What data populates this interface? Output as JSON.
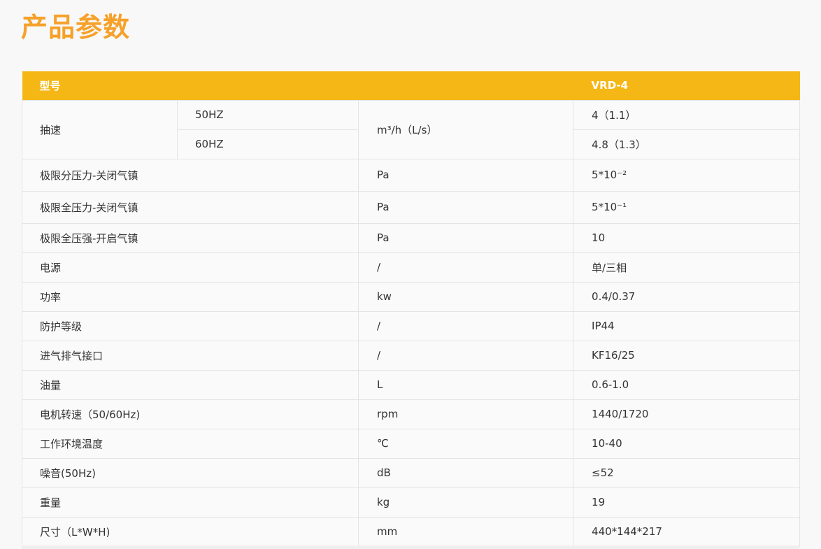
{
  "page_title": "产品参数",
  "header": {
    "model_label": "型号",
    "model_value": "VRD-4"
  },
  "speed": {
    "label": "抽速",
    "freq_50": "50HZ",
    "freq_60": "60HZ",
    "unit": "m³/h（L/s）",
    "value_50": "4（1.1）",
    "value_60": "4.8（1.3）"
  },
  "rows": [
    {
      "name": "极限分压力-关闭气镇",
      "unit": "Pa",
      "value": "5*10⁻²"
    },
    {
      "name": "极限全压力-关闭气镇",
      "unit": "Pa",
      "value": "5*10⁻¹"
    },
    {
      "name": "极限全压强-开启气镇",
      "unit": "Pa",
      "value": "10"
    },
    {
      "name": "电源",
      "unit": "/",
      "value": "单/三相"
    },
    {
      "name": "功率",
      "unit": "kw",
      "value": "0.4/0.37"
    },
    {
      "name": "防护等级",
      "unit": "/",
      "value": "IP44"
    },
    {
      "name": "进气排气接口",
      "unit": "/",
      "value": "KF16/25"
    },
    {
      "name": "油量",
      "unit": "L",
      "value": "0.6-1.0"
    },
    {
      "name": "电机转速（50/60Hz)",
      "unit": "rpm",
      "value": "1440/1720"
    },
    {
      "name": "工作环境温度",
      "unit": "℃",
      "value": "10-40"
    },
    {
      "name": "噪音(50Hz)",
      "unit": "dB",
      "value": "≤52"
    },
    {
      "name": "重量",
      "unit": "kg",
      "value": "19"
    },
    {
      "name": "尺寸（L*W*H)",
      "unit": "mm",
      "value": "440*144*217"
    }
  ],
  "colors": {
    "title": "#f6a12a",
    "header_bg": "#f5b716",
    "header_text": "#ffffff",
    "text": "#333333",
    "border": "#e4e4e4"
  }
}
